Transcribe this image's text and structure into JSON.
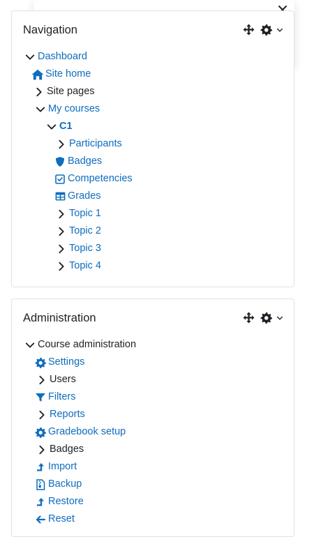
{
  "navigation": {
    "title": "Navigation",
    "items": {
      "dashboard": "Dashboard",
      "site_home": "Site home",
      "site_pages": "Site pages",
      "my_courses": "My courses",
      "c1": "C1",
      "participants": "Participants",
      "badges": "Badges",
      "competencies": "Competencies",
      "grades": "Grades",
      "topic1": "Topic 1",
      "topic2": "Topic 2",
      "topic3": "Topic 3",
      "topic4": "Topic 4"
    }
  },
  "administration": {
    "title": "Administration",
    "items": {
      "course_admin": "Course administration",
      "settings": "Settings",
      "users": "Users",
      "filters": "Filters",
      "reports": "Reports",
      "gradebook": "Gradebook setup",
      "badges": "Badges",
      "import": "Import",
      "backup": "Backup",
      "restore": "Restore",
      "reset": "Reset"
    }
  },
  "colors": {
    "link": "#0f6cbf",
    "text": "#1d2125",
    "border": "#dee2e6",
    "icon": "#1d2125"
  }
}
